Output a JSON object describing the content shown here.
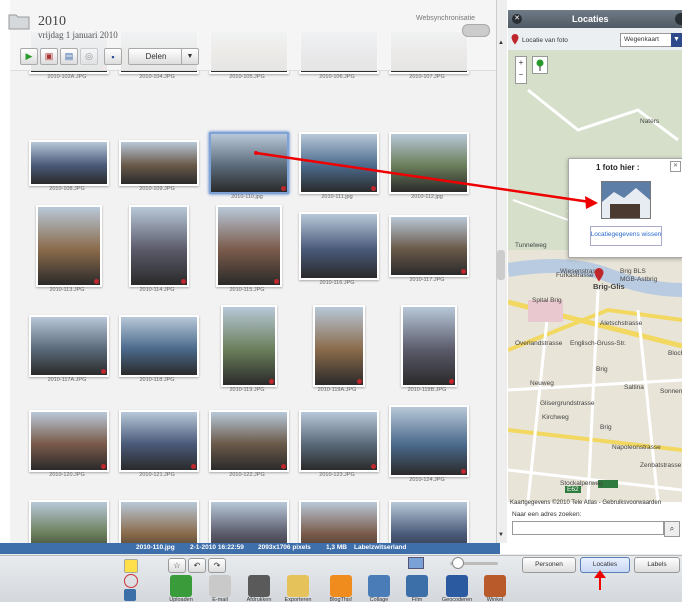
{
  "album": {
    "title": "2010",
    "date": "vrijdag 1 januari 2010"
  },
  "web_sync_label": "Websynchronisatie",
  "toolbar": {
    "share_label": "Delen"
  },
  "photos": [
    {
      "caption": "2010-102A.JPG",
      "pin": true
    },
    {
      "caption": "2010-104.JPG",
      "pin": false
    },
    {
      "caption": "2010-105.JPG",
      "pin": false
    },
    {
      "caption": "2010-106.JPG",
      "pin": false
    },
    {
      "caption": "2010-107.JPG",
      "pin": false
    },
    {
      "caption": "2010-108.JPG",
      "pin": false
    },
    {
      "caption": "2010-109.JPG",
      "pin": false
    },
    {
      "caption": "2010-110.jpg",
      "pin": true
    },
    {
      "caption": "2010-111.jpg",
      "pin": true
    },
    {
      "caption": "2010-112.jpg",
      "pin": false
    },
    {
      "caption": "2010-113.JPG",
      "pin": true
    },
    {
      "caption": "2010-114.JPG",
      "pin": true
    },
    {
      "caption": "2010-115.JPG",
      "pin": true
    },
    {
      "caption": "2010-116.JPG",
      "pin": false
    },
    {
      "caption": "2010-117.JPG",
      "pin": true
    },
    {
      "caption": "2010-117A.JPG",
      "pin": true
    },
    {
      "caption": "2010-118.JPG",
      "pin": false
    },
    {
      "caption": "2010-119.JPG",
      "pin": true
    },
    {
      "caption": "2010-119A.JPG",
      "pin": true
    },
    {
      "caption": "2010-119B.JPG",
      "pin": true
    },
    {
      "caption": "2010-120.JPG",
      "pin": true
    },
    {
      "caption": "2010-121.JPG",
      "pin": true
    },
    {
      "caption": "2010-122.JPG",
      "pin": true
    },
    {
      "caption": "2010-123.JPG",
      "pin": true
    },
    {
      "caption": "2010-124.JPG",
      "pin": true
    },
    {
      "caption": "",
      "pin": false
    },
    {
      "caption": "",
      "pin": false
    },
    {
      "caption": "",
      "pin": false
    },
    {
      "caption": "",
      "pin": false
    },
    {
      "caption": "",
      "pin": false
    }
  ],
  "right_panel": {
    "title": "Locaties",
    "location_label": "Locatie van foto",
    "map_type": "Wegenkaart",
    "popup_title": "1 foto hier :",
    "popup_link": "Locatiegegevens wissen",
    "map_labels": [
      "Naters",
      "Brig-Glis",
      "Spital Brig",
      "Brig",
      "Brig",
      "Wiesenstrasse",
      "Furkastrasse",
      "Englisch-Gruss-Str.",
      "Saltina",
      "Kirchweg",
      "Napoleonstrasse",
      "Zenbatstrasse",
      "Aletschstrasse",
      "Sonnenweg",
      "Overlandstrasse",
      "Glisergrundstrasse",
      "Brig BLS",
      "MGB-Astbrig",
      "Tunnelweg",
      "Neuweg",
      "Bloch",
      "Stockalperweg",
      "E62"
    ],
    "copyright": "Kaartgegevens ©2010 Tele Atlas - Gebruiksvoorwaarden",
    "address_label": "Naar een adres zoeken:"
  },
  "status": {
    "filename": "2010-110.jpg",
    "datetime": "2-1-2010 16:22:59",
    "dimensions": "2093x1706 pixels",
    "size": "1,3 MB",
    "label": "Labelzwitserland"
  },
  "bottom_tools": [
    {
      "label": "Uploaden",
      "color": "#3a9b3a"
    },
    {
      "label": "E-mail",
      "color": "#c9c9c9"
    },
    {
      "label": "Afdrukken",
      "color": "#5a5a5a"
    },
    {
      "label": "Exporteren",
      "color": "#e6c35a"
    },
    {
      "label": "BlogThis!",
      "color": "#f08c1e"
    },
    {
      "label": "Collage",
      "color": "#4a7db8"
    },
    {
      "label": "Film",
      "color": "#3c6ea8"
    },
    {
      "label": "Geocoderen",
      "color": "#2c5aa0"
    },
    {
      "label": "Winkel",
      "color": "#b85a2a"
    }
  ],
  "panel_tabs": [
    {
      "label": "Personen"
    },
    {
      "label": "Locaties"
    },
    {
      "label": "Labels"
    }
  ],
  "colors": {
    "accent": "#3f6fab",
    "arrow": "#e00000",
    "pin": "#c0272d"
  }
}
